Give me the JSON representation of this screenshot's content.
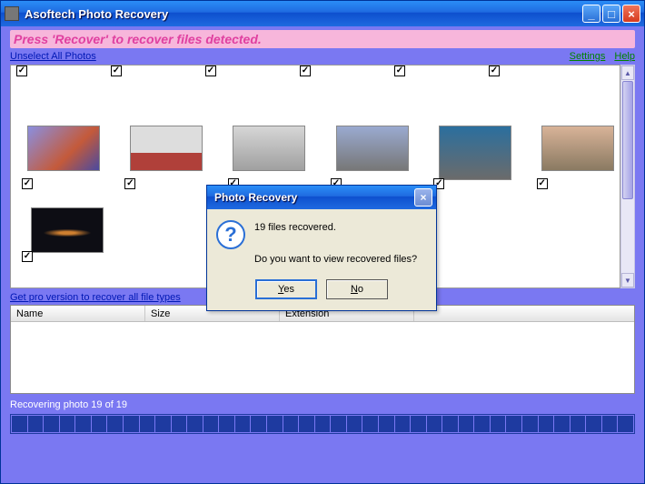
{
  "window": {
    "title": "Asoftech Photo Recovery"
  },
  "content": {
    "instruction": "Press 'Recover' to recover files detected.",
    "links": {
      "unselect": "Unselect All Photos",
      "settings": "Settings",
      "help": "Help",
      "pro": "Get pro version to recover all file types"
    },
    "table": {
      "headers": {
        "name": "Name",
        "size": "Size",
        "ext": "Extension"
      }
    },
    "status": "Recovering photo 19 of 19"
  },
  "dialog": {
    "title": "Photo Recovery",
    "line1": "19 files recovered.",
    "line2": "Do you want to view recovered files?",
    "yes_first": "Y",
    "yes_rest": "es",
    "no_first": "N",
    "no_rest": "o"
  }
}
